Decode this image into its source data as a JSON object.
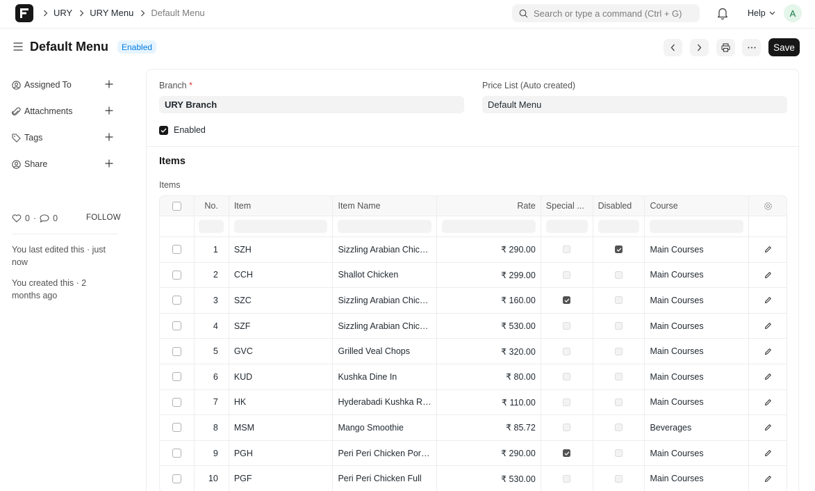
{
  "navbar": {
    "breadcrumbs": [
      "URY",
      "URY Menu",
      "Default Menu"
    ],
    "search_placeholder": "Search or type a command (Ctrl + G)",
    "help_label": "Help",
    "avatar_initial": "A"
  },
  "page": {
    "title": "Default Menu",
    "status": "Enabled",
    "save_label": "Save"
  },
  "sidebar": {
    "items": [
      {
        "label": "Assigned To",
        "icon": "assign-user-icon"
      },
      {
        "label": "Attachments",
        "icon": "paperclip-icon"
      },
      {
        "label": "Tags",
        "icon": "tag-icon"
      },
      {
        "label": "Share",
        "icon": "share-user-icon"
      }
    ],
    "likes_count": "0",
    "comments_count": "0",
    "follow_label": "FOLLOW",
    "last_edited": "You last edited this · just now",
    "created": "You created this · 2 months ago"
  },
  "form": {
    "branch_label": "Branch",
    "branch_required": "*",
    "branch_value": "URY Branch",
    "price_list_label": "Price List (Auto created)",
    "price_list_value": "Default Menu",
    "enabled_label": "Enabled",
    "enabled_checked": true,
    "section_title": "Items",
    "items_table_label": "Items"
  },
  "table": {
    "columns": [
      "No.",
      "Item",
      "Item Name",
      "Rate",
      "Special ...",
      "Disabled",
      "Course"
    ],
    "rows": [
      {
        "no": "1",
        "item": "SZH",
        "item_name": "Sizzling Arabian Chicken Half",
        "rate": "₹ 290.00",
        "special": false,
        "disabled": true,
        "course": "Main Courses"
      },
      {
        "no": "2",
        "item": "CCH",
        "item_name": "Shallot Chicken",
        "rate": "₹ 299.00",
        "special": false,
        "disabled": false,
        "course": "Main Courses"
      },
      {
        "no": "3",
        "item": "SZC",
        "item_name": "Sizzling Arabian Chicken Quarter",
        "rate": "₹ 160.00",
        "special": true,
        "disabled": false,
        "course": "Main Courses"
      },
      {
        "no": "4",
        "item": "SZF",
        "item_name": "Sizzling Arabian Chicken Full",
        "rate": "₹ 530.00",
        "special": false,
        "disabled": false,
        "course": "Main Courses"
      },
      {
        "no": "5",
        "item": "GVC",
        "item_name": "Grilled Veal Chops",
        "rate": "₹ 320.00",
        "special": false,
        "disabled": false,
        "course": "Main Courses"
      },
      {
        "no": "6",
        "item": "KUD",
        "item_name": "Kushka Dine In",
        "rate": "₹ 80.00",
        "special": false,
        "disabled": false,
        "course": "Main Courses"
      },
      {
        "no": "7",
        "item": "HK",
        "item_name": "Hyderabadi Kushka Rice",
        "rate": "₹ 110.00",
        "special": false,
        "disabled": false,
        "course": "Main Courses"
      },
      {
        "no": "8",
        "item": "MSM",
        "item_name": "Mango Smoothie",
        "rate": "₹ 85.72",
        "special": false,
        "disabled": false,
        "course": "Beverages"
      },
      {
        "no": "9",
        "item": "PGH",
        "item_name": "Peri Peri Chicken Portion",
        "rate": "₹ 290.00",
        "special": true,
        "disabled": false,
        "course": "Main Courses"
      },
      {
        "no": "10",
        "item": "PGF",
        "item_name": "Peri Peri Chicken Full",
        "rate": "₹ 530.00",
        "special": false,
        "disabled": false,
        "course": "Main Courses"
      }
    ]
  }
}
